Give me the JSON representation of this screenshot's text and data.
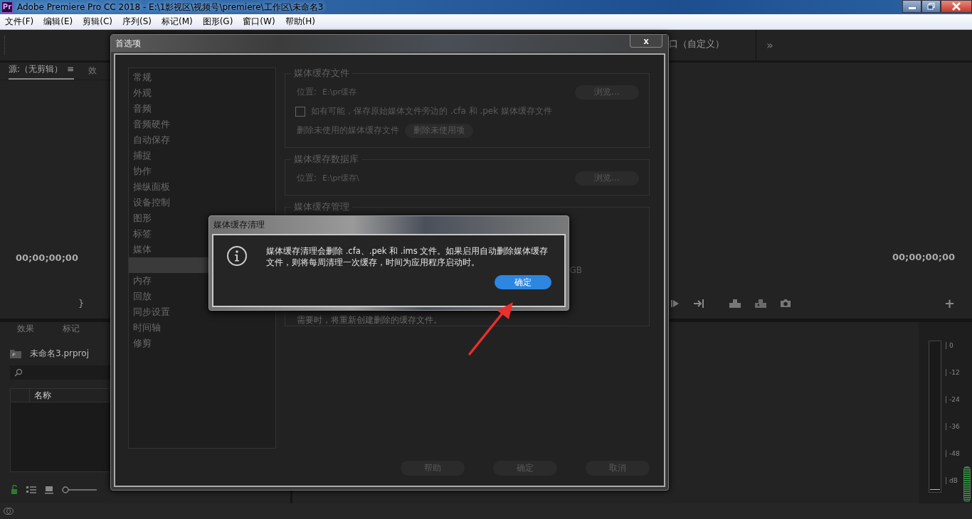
{
  "window": {
    "app_icon": "Pr",
    "title": "Adobe Premiere Pro CC 2018 - E:\\1影视区\\视频号\\premiere\\工作区\\未命名3"
  },
  "menu": [
    "文件(F)",
    "编辑(E)",
    "剪辑(C)",
    "序列(S)",
    "标记(M)",
    "图形(G)",
    "窗口(W)",
    "帮助(H)"
  ],
  "workspace": {
    "tab": "口（自定义）",
    "more": "»"
  },
  "source_panel": {
    "tabs": [
      {
        "label": "源:（无剪辑）",
        "selected": true
      },
      {
        "label": "效",
        "selected": false
      }
    ],
    "menu_glyph": "≡",
    "timecode": "00;00;00;00",
    "marker": "}"
  },
  "program_panel": {
    "timecode": "00;00;00;00",
    "add": "+"
  },
  "project_panel": {
    "tabs": [
      {
        "label": "效果",
        "selected": false
      },
      {
        "label": "标记",
        "selected": false
      }
    ],
    "project_name": "未命名3.prproj",
    "column": "名称"
  },
  "audio_meter": {
    "ticks": [
      "0",
      "-12",
      "-24",
      "-36",
      "-48",
      "dB"
    ]
  },
  "preferences": {
    "title": "首选项",
    "close": "x",
    "categories": [
      {
        "label": "常规",
        "selected": false
      },
      {
        "label": "外观",
        "selected": false
      },
      {
        "label": "音频",
        "selected": false
      },
      {
        "label": "音频硬件",
        "selected": false
      },
      {
        "label": "自动保存",
        "selected": false
      },
      {
        "label": "捕捉",
        "selected": false
      },
      {
        "label": "协作",
        "selected": false
      },
      {
        "label": "操纵面板",
        "selected": false
      },
      {
        "label": "设备控制",
        "selected": false
      },
      {
        "label": "图形",
        "selected": false
      },
      {
        "label": "标签",
        "selected": false
      },
      {
        "label": "媒体",
        "selected": false
      },
      {
        "selected": true
      },
      {
        "label": "内存",
        "selected": false
      },
      {
        "label": "回放",
        "selected": false
      },
      {
        "label": "同步设置",
        "selected": false
      },
      {
        "label": "时间轴",
        "selected": false
      },
      {
        "label": "修剪",
        "selected": false
      }
    ],
    "groups": [
      {
        "title": "媒体缓存文件",
        "rows": [
          {
            "kind": "location",
            "label": "位置:",
            "value": "E:\\pr缓存",
            "button": "浏览..."
          },
          {
            "kind": "checkbox",
            "label": "如有可能，保存原始媒体文件旁边的 .cfa 和 .pek 媒体缓存文件",
            "checked": false
          },
          {
            "kind": "action",
            "label": "删除未使用的媒体缓存文件",
            "button": "删除未使用项"
          }
        ]
      },
      {
        "title": "媒体缓存数据库",
        "rows": [
          {
            "kind": "location",
            "label": "位置:",
            "value": "E:\\pr缓存\\",
            "button": "浏览..."
          }
        ]
      },
      {
        "title": "媒体缓存管理",
        "rows": [
          {
            "kind": "unit",
            "label": "GB"
          },
          {
            "kind": "note",
            "label": "需要时，将重新创建删除的缓存文件。"
          }
        ]
      }
    ],
    "buttons": [
      "帮助",
      "确定",
      "取消"
    ]
  },
  "alert": {
    "title": "媒体缓存清理",
    "message": "媒体缓存清理会删除 .cfa、.pek 和 .ims 文件。如果启用自动删除媒体缓存文件，则将每周清理一次缓存，时间为应用程序启动时。",
    "button": "确定"
  },
  "annotation": {
    "kind": "arrow"
  }
}
